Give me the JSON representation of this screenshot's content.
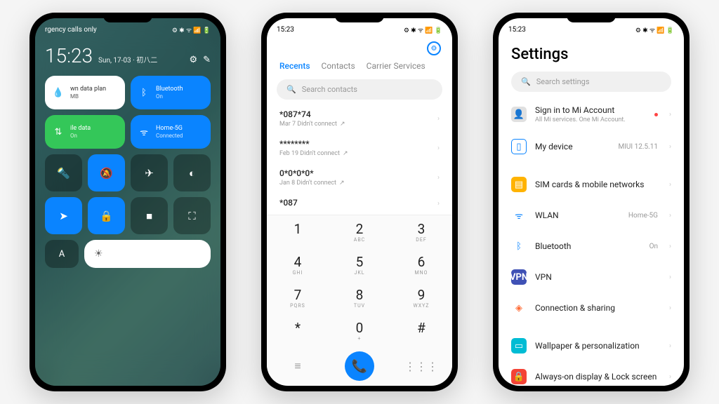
{
  "statusbar": {
    "time": "15:23",
    "carrier": "rgency calls only",
    "icons": "⚙ ✱ ᯤ 📶 🔋"
  },
  "cc": {
    "time": "15:23",
    "date": "Sun, 17-03 · 初八二",
    "tiles": {
      "data_plan": {
        "label": "wn data plan",
        "sub": "MB"
      },
      "bluetooth": {
        "label": "Bluetooth",
        "sub": "On"
      },
      "mobile_data": {
        "label": "ile data",
        "sub": "On"
      },
      "wifi": {
        "label": "Home-5G",
        "sub": "Connected"
      }
    }
  },
  "dialer": {
    "tabs": {
      "recents": "Recents",
      "contacts": "Contacts",
      "carrier": "Carrier Services"
    },
    "search_placeholder": "Search contacts",
    "calls": [
      {
        "num": "*087*74",
        "meta": "Mar 7 Didn't connect"
      },
      {
        "num": "********",
        "meta": "Feb 19 Didn't connect"
      },
      {
        "num": "0*0*0*0*",
        "meta": "Jan 8 Didn't connect"
      },
      {
        "num": "*087",
        "meta": ""
      }
    ],
    "keys": [
      {
        "n": "1",
        "l": ""
      },
      {
        "n": "2",
        "l": "ABC"
      },
      {
        "n": "3",
        "l": "DEF"
      },
      {
        "n": "4",
        "l": "GHI"
      },
      {
        "n": "5",
        "l": "JKL"
      },
      {
        "n": "6",
        "l": "MNO"
      },
      {
        "n": "7",
        "l": "PQRS"
      },
      {
        "n": "8",
        "l": "TUV"
      },
      {
        "n": "9",
        "l": "WXYZ"
      },
      {
        "n": "*",
        "l": ""
      },
      {
        "n": "0",
        "l": "+"
      },
      {
        "n": "#",
        "l": ""
      }
    ]
  },
  "settings": {
    "title": "Settings",
    "search_placeholder": "Search settings",
    "account": {
      "title": "Sign in to Mi Account",
      "sub": "All Mi services. One Mi Account."
    },
    "device": {
      "title": "My device",
      "val": "MIUI 12.5.11"
    },
    "items": [
      {
        "title": "SIM cards & mobile networks",
        "val": ""
      },
      {
        "title": "WLAN",
        "val": "Home-5G"
      },
      {
        "title": "Bluetooth",
        "val": "On"
      },
      {
        "title": "VPN",
        "val": ""
      },
      {
        "title": "Connection & sharing",
        "val": ""
      }
    ],
    "items2": [
      {
        "title": "Wallpaper & personalization",
        "val": ""
      },
      {
        "title": "Always-on display & Lock screen",
        "val": ""
      }
    ]
  }
}
